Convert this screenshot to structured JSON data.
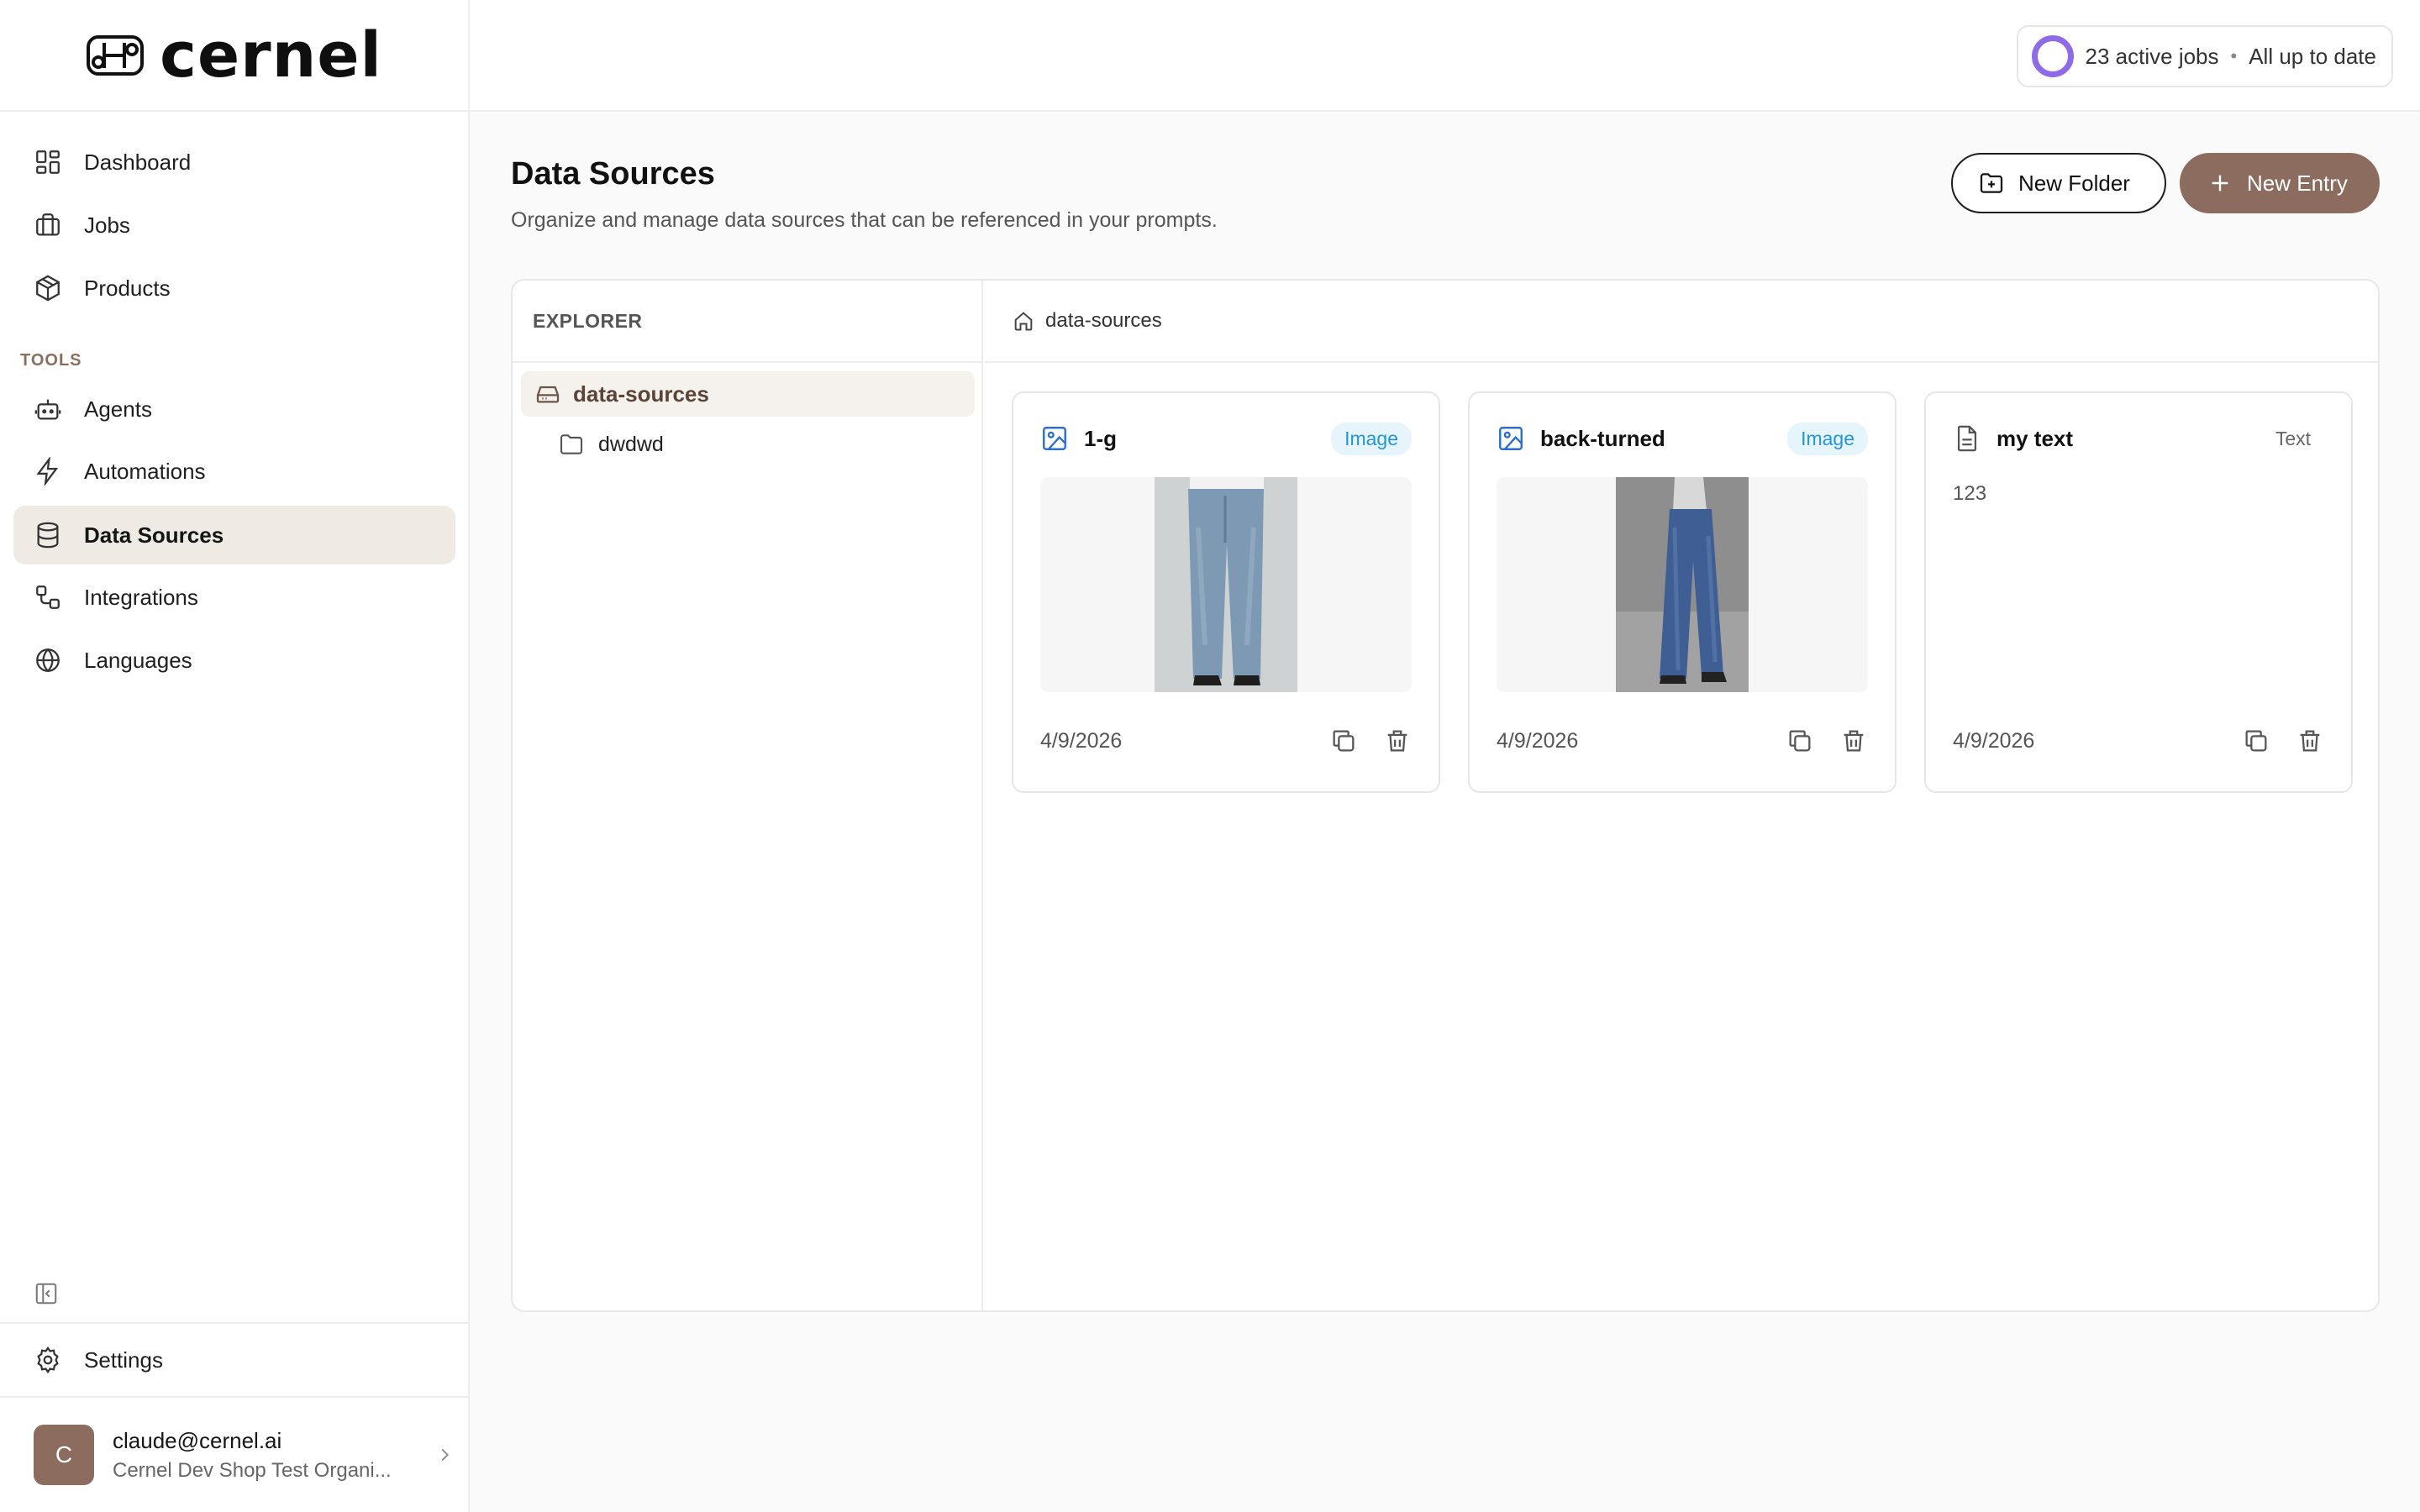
{
  "brand": {
    "name": "cernel"
  },
  "sidebar": {
    "main_items": [
      {
        "label": "Dashboard",
        "icon": "dashboard-icon"
      },
      {
        "label": "Jobs",
        "icon": "briefcase-icon"
      },
      {
        "label": "Products",
        "icon": "box-icon"
      }
    ],
    "tools_label": "TOOLS",
    "tool_items": [
      {
        "label": "Agents",
        "icon": "robot-icon"
      },
      {
        "label": "Automations",
        "icon": "lightning-icon"
      },
      {
        "label": "Data Sources",
        "icon": "database-icon",
        "active": true
      },
      {
        "label": "Integrations",
        "icon": "integrations-icon"
      },
      {
        "label": "Languages",
        "icon": "globe-icon"
      }
    ],
    "settings_label": "Settings",
    "user": {
      "initial": "C",
      "email": "claude@cernel.ai",
      "org": "Cernel Dev Shop Test Organi..."
    }
  },
  "topbar": {
    "jobs_text": "23 active jobs",
    "separator": "•",
    "status_text": "All up to date",
    "ring_color": "#8f6be8"
  },
  "page": {
    "title": "Data Sources",
    "subtitle": "Organize and manage data sources that can be referenced in your prompts.",
    "new_folder_label": "New Folder",
    "new_entry_label": "New Entry",
    "accent_color": "#8c6c5e"
  },
  "explorer": {
    "heading": "EXPLORER",
    "root": "data-sources",
    "children": [
      "dwdwd"
    ]
  },
  "content": {
    "breadcrumb": "data-sources",
    "cards": [
      {
        "title": "1-g",
        "type": "Image",
        "date": "4/9/2026"
      },
      {
        "title": "back-turned",
        "type": "Image",
        "date": "4/9/2026"
      },
      {
        "title": "my text",
        "type": "Text",
        "body": "123",
        "date": "4/9/2026"
      }
    ]
  }
}
